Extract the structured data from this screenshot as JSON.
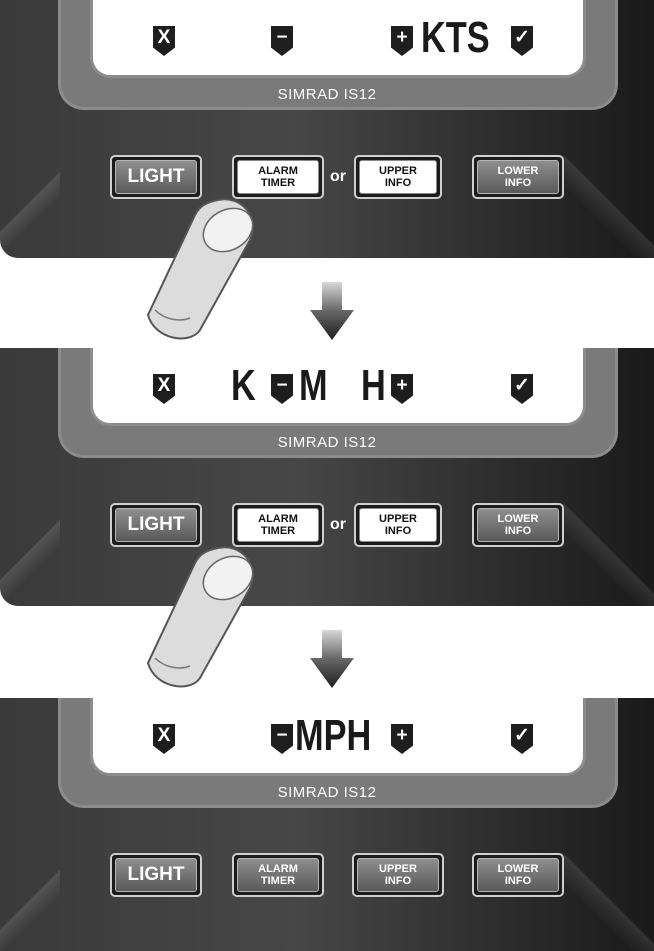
{
  "brand": "SIMRAD IS12",
  "buttons": {
    "light": "LIGHT",
    "alarm_line1": "ALARM",
    "alarm_line2": "TIMER",
    "or": "or",
    "upper_line1": "UPPER",
    "upper_line2": "INFO",
    "lower_line1": "LOWER",
    "lower_line2": "INFO"
  },
  "panel1": {
    "cancel": "X",
    "minus": "−",
    "plus": "+",
    "unit": "KTS",
    "confirm": "✓"
  },
  "panel2": {
    "cancel": "X",
    "letter_k": "K",
    "minus": "−",
    "letter_m": "M",
    "letter_h": "H",
    "plus": "+",
    "confirm": "✓"
  },
  "panel3": {
    "cancel": "X",
    "minus": "−",
    "unit": "MPH",
    "plus": "+",
    "confirm": "✓"
  },
  "colors": {
    "bezel": "#3a3a3a",
    "frame": "#8c8c8c",
    "lcd": "#ffffff"
  }
}
